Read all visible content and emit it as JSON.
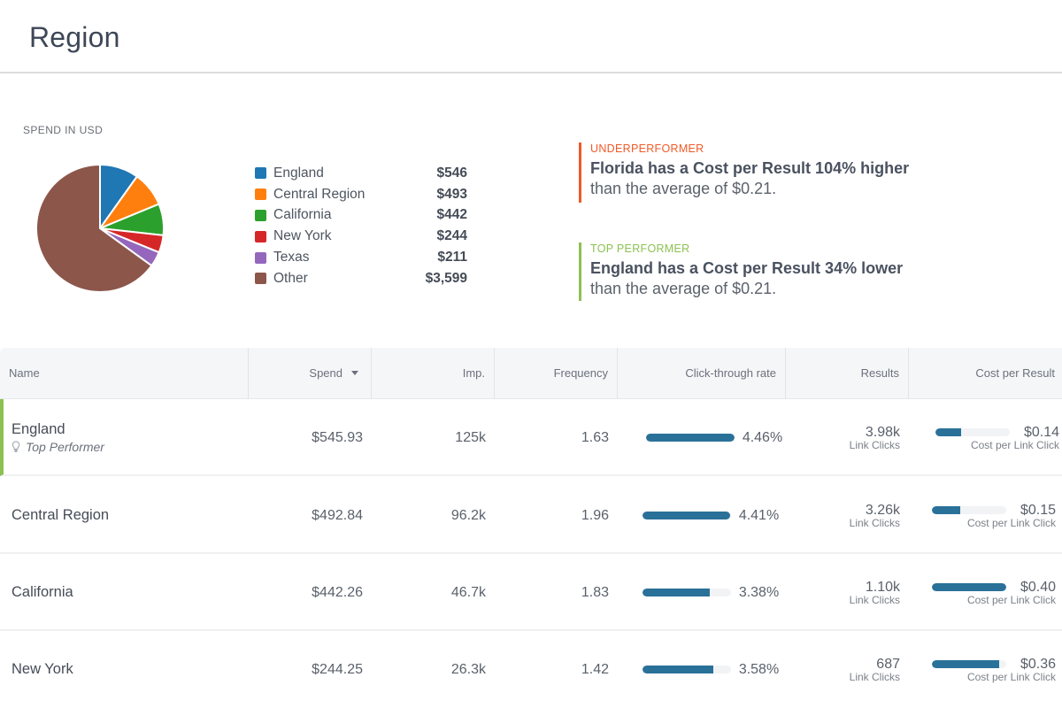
{
  "header": {
    "title": "Region"
  },
  "spend_section": {
    "label": "SPEND IN USD",
    "legend": [
      {
        "name": "England",
        "value": "$546",
        "amount": 546,
        "color": "#1f77b4"
      },
      {
        "name": "Central Region",
        "value": "$493",
        "amount": 493,
        "color": "#ff7f0e"
      },
      {
        "name": "California",
        "value": "$442",
        "amount": 442,
        "color": "#2ca02c"
      },
      {
        "name": "New York",
        "value": "$244",
        "amount": 244,
        "color": "#d62728"
      },
      {
        "name": "Texas",
        "value": "$211",
        "amount": 211,
        "color": "#9467bd"
      },
      {
        "name": "Other",
        "value": "$3,599",
        "amount": 3599,
        "color": "#8c564b"
      }
    ]
  },
  "chart_data": {
    "type": "pie",
    "title": "SPEND IN USD",
    "categories": [
      "England",
      "Central Region",
      "California",
      "New York",
      "Texas",
      "Other"
    ],
    "values": [
      546,
      493,
      442,
      244,
      211,
      3599
    ],
    "colors": [
      "#1f77b4",
      "#ff7f0e",
      "#2ca02c",
      "#d62728",
      "#9467bd",
      "#8c564b"
    ],
    "legend": "right"
  },
  "insights": {
    "underperformer": {
      "tag": "UNDERPERFORMER",
      "headline": "Florida has a Cost per Result 104% higher",
      "sub": "than the average of $0.21.",
      "color": "#f05a28"
    },
    "top_performer": {
      "tag": "TOP PERFORMER",
      "headline": "England has a Cost per Result 34% lower",
      "sub": "than the average of $0.21.",
      "color": "#8cc152"
    }
  },
  "table": {
    "columns": {
      "name": "Name",
      "spend": "Spend",
      "imp": "Imp.",
      "frequency": "Frequency",
      "ctr": "Click-through rate",
      "results": "Results",
      "cpr": "Cost per Result"
    },
    "sorted_by": "Spend",
    "rows": [
      {
        "name": "England",
        "badge": "Top Performer",
        "spend": "$545.93",
        "imp": "125k",
        "frequency": "1.63",
        "ctr": "4.46%",
        "ctr_fill": 1.0,
        "results": "3.98k",
        "results_label": "Link Clicks",
        "cpr": "$0.14",
        "cpr_fill": 0.35,
        "cpr_label": "Cost per Link Click"
      },
      {
        "name": "Central Region",
        "spend": "$492.84",
        "imp": "96.2k",
        "frequency": "1.96",
        "ctr": "4.41%",
        "ctr_fill": 0.99,
        "results": "3.26k",
        "results_label": "Link Clicks",
        "cpr": "$0.15",
        "cpr_fill": 0.375,
        "cpr_label": "Cost per Link Click"
      },
      {
        "name": "California",
        "spend": "$442.26",
        "imp": "46.7k",
        "frequency": "1.83",
        "ctr": "3.38%",
        "ctr_fill": 0.76,
        "results": "1.10k",
        "results_label": "Link Clicks",
        "cpr": "$0.40",
        "cpr_fill": 1.0,
        "cpr_label": "Cost per Link Click"
      },
      {
        "name": "New York",
        "spend": "$244.25",
        "imp": "26.3k",
        "frequency": "1.42",
        "ctr": "3.58%",
        "ctr_fill": 0.8,
        "results": "687",
        "results_label": "Link Clicks",
        "cpr": "$0.36",
        "cpr_fill": 0.9,
        "cpr_label": "Cost per Link Click"
      }
    ]
  }
}
